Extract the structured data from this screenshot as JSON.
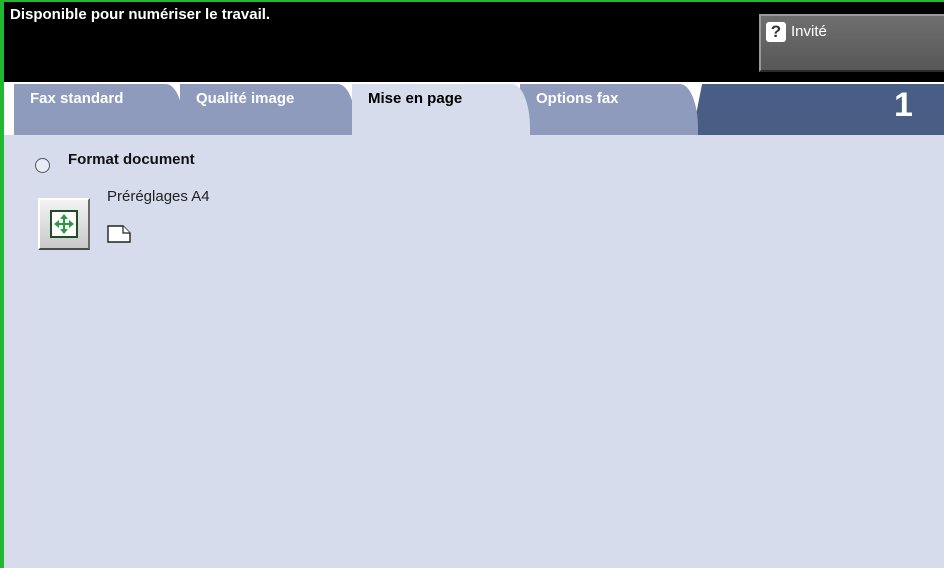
{
  "status": {
    "message": "Disponible pour numériser le travail."
  },
  "user": {
    "label": "Invité",
    "icon": "help-question-icon"
  },
  "tabs": [
    {
      "label": "Fax standard",
      "active": false
    },
    {
      "label": "Qualité image",
      "active": false
    },
    {
      "label": "Mise en page",
      "active": true
    },
    {
      "label": "Options fax",
      "active": false
    }
  ],
  "tab_count_badge": "1",
  "layout": {
    "format_label": "Format document",
    "format_selected": false,
    "preset_label": "Préréglages A4",
    "size_icon": "resize-arrows-icon",
    "page_icon": "page-portrait-icon"
  },
  "colors": {
    "accent_green": "#22b832",
    "tab_inactive": "#8e9bbd",
    "tab_active_and_panel": "#d6dcec",
    "tab_strip": "#495e85",
    "status_bar": "#000000"
  }
}
